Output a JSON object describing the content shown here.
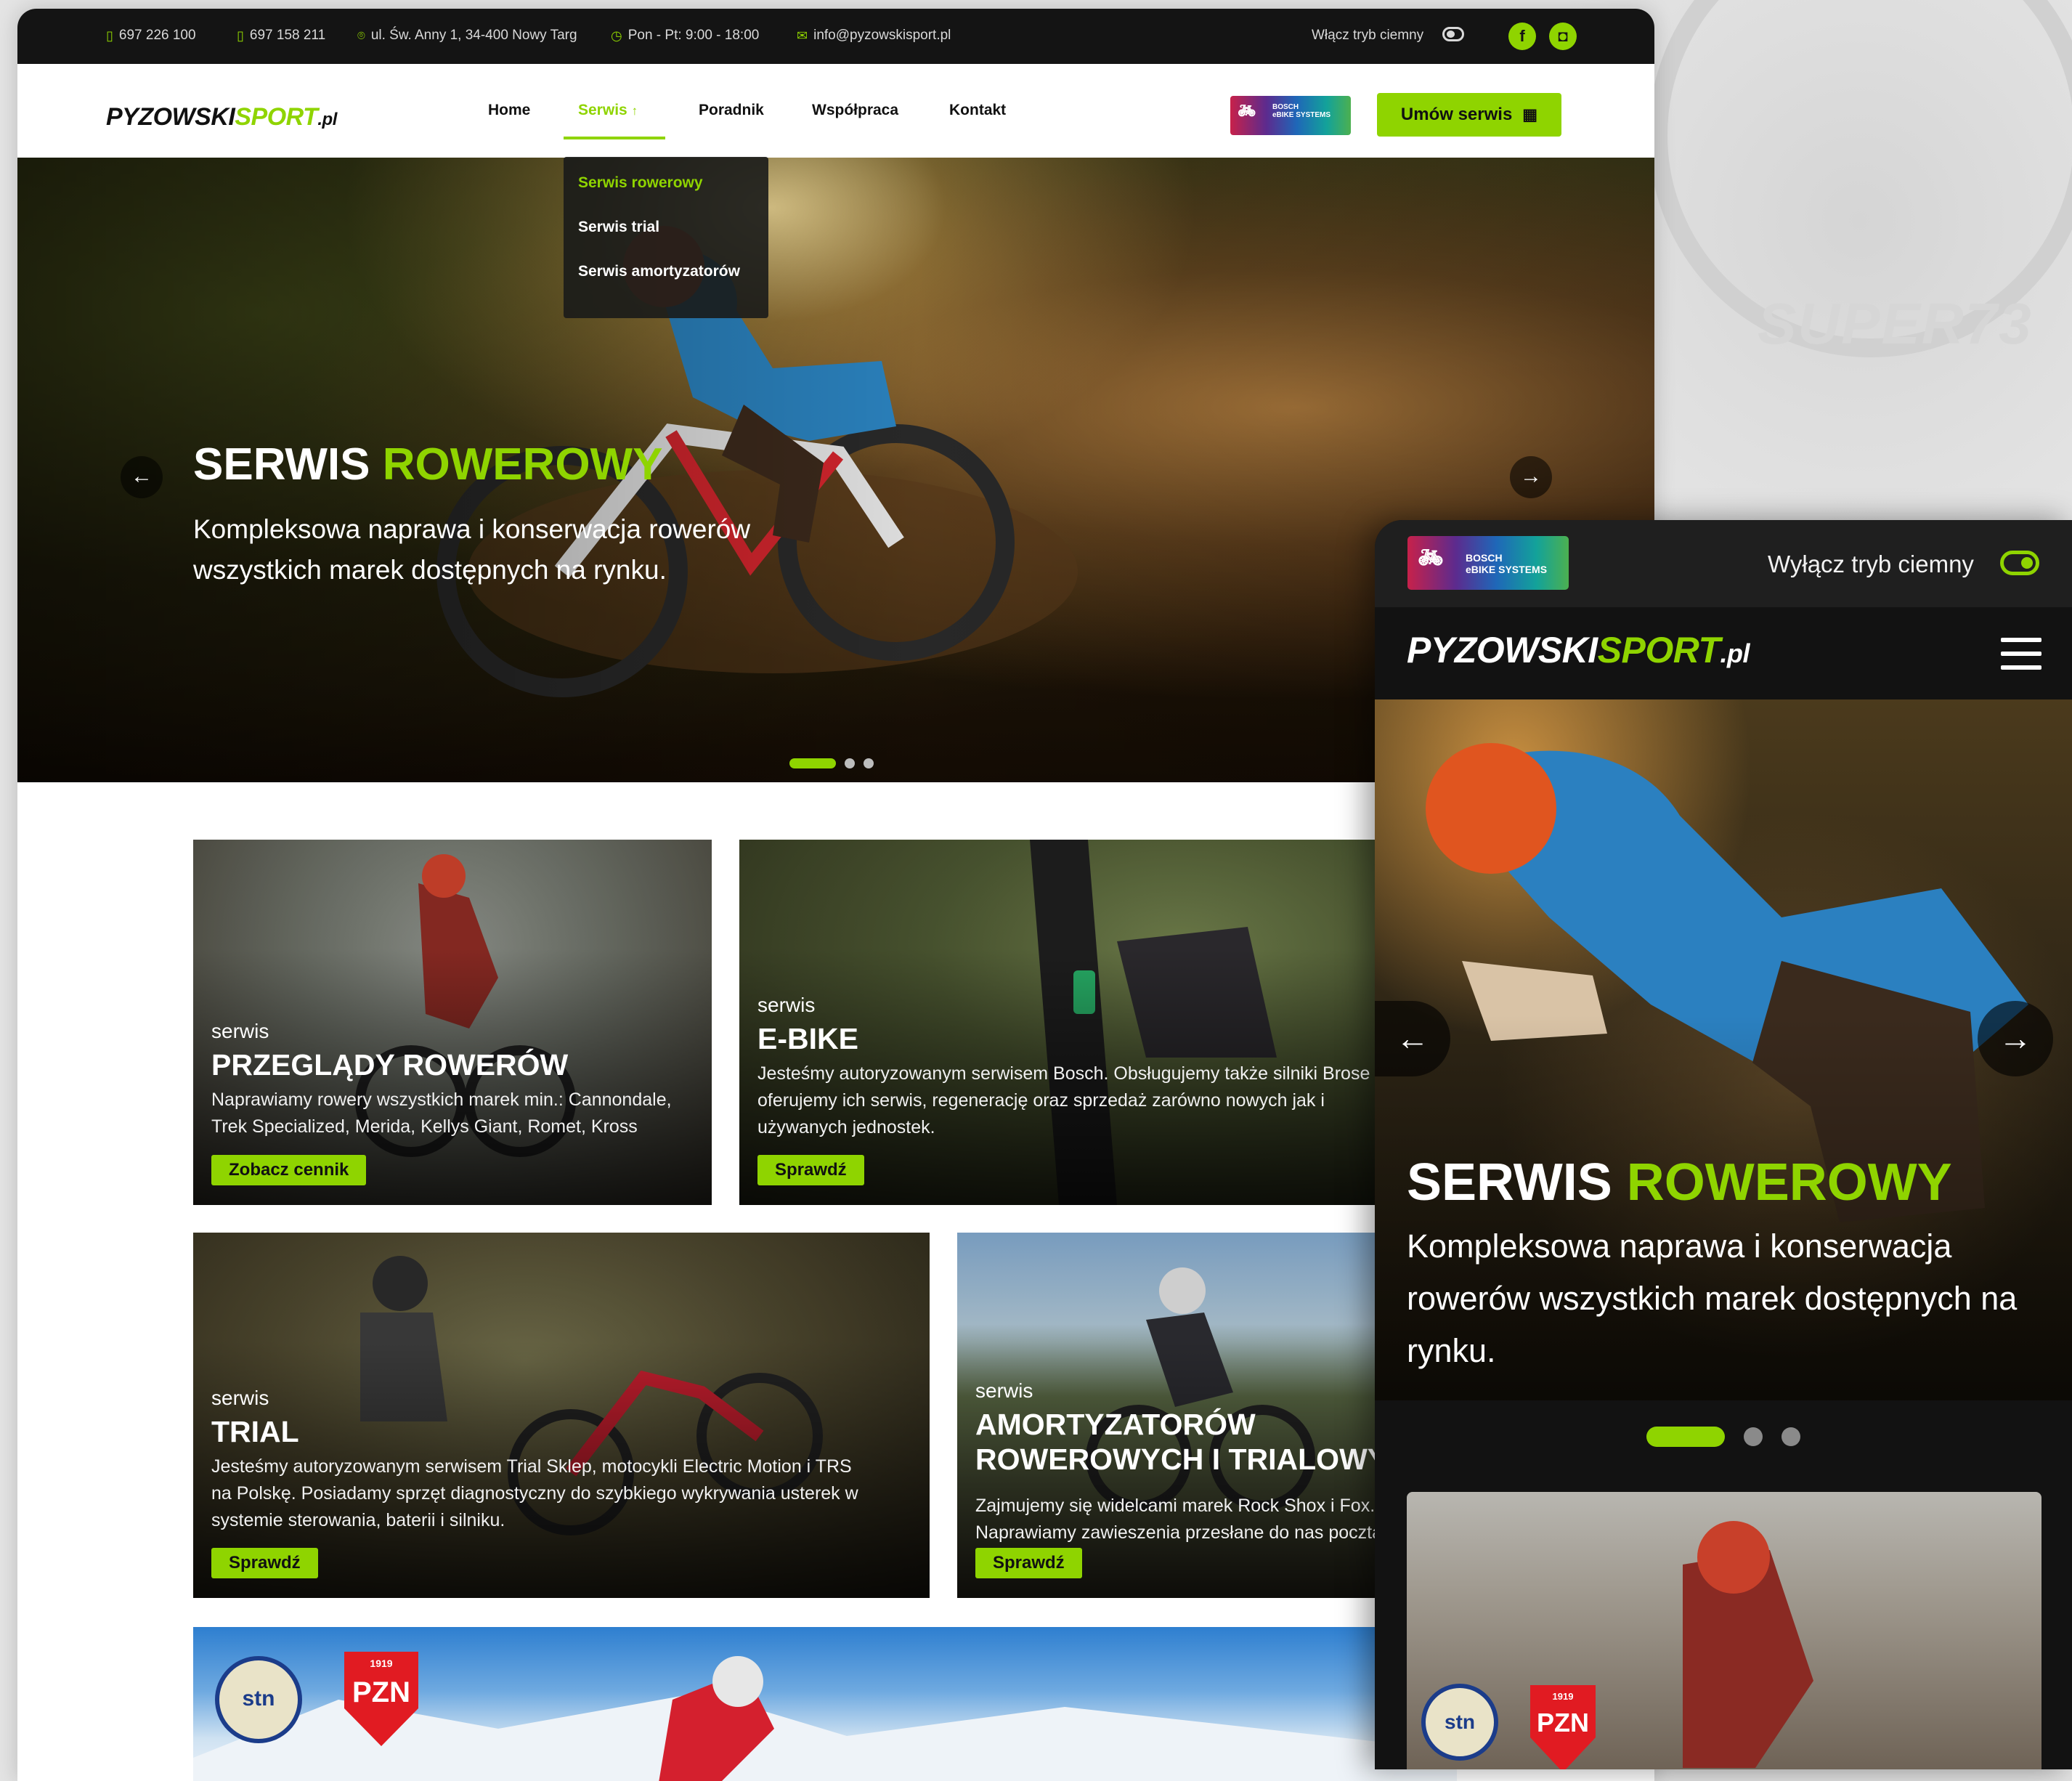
{
  "topbar": {
    "phone1": "697 226 100",
    "phone2": "697 158 211",
    "address": "ul. Św. Anny 1, 34-400 Nowy Targ",
    "hours": "Pon - Pt: 9:00 - 18:00",
    "email": "info@pyzowskisport.pl",
    "dark_mode_label": "Włącz tryb ciemny",
    "social": [
      {
        "icon": "facebook-icon"
      },
      {
        "icon": "instagram-icon"
      }
    ]
  },
  "brand": {
    "name_a": "PYZOWSKI",
    "name_b": "SPORT",
    "tld": ".pl",
    "accent": "#8fd400"
  },
  "nav": {
    "items": [
      "Home",
      "Serwis",
      "Poradnik",
      "Współpraca",
      "Kontakt"
    ],
    "active": "Serwis",
    "dropdown": [
      "Serwis rowerowy",
      "Serwis trial",
      "Serwis amortyzatorów"
    ],
    "bosch_line1": "BOSCH",
    "bosch_line2": "eBIKE SYSTEMS",
    "cta": "Umów serwis"
  },
  "hero": {
    "title_a": "SERWIS ",
    "title_b": "ROWEROWY",
    "subtitle": "Kompleksowa naprawa i konserwacja rowerów wszystkich marek dostępnych na rynku.",
    "slide_count": 3,
    "active_slide": 1
  },
  "cards": [
    {
      "kicker": "serwis",
      "title": "PRZEGLĄDY ROWERÓW",
      "desc": "Naprawiamy rowery wszystkich marek min.: Cannondale, Trek Specialized, Merida, Kellys Giant, Romet, Kross",
      "button": "Zobacz cennik"
    },
    {
      "kicker": "serwis",
      "title": "E-BIKE",
      "desc": "Jesteśmy autoryzowanym serwisem Bosch. Obsługujemy także silniki Brose – oferujemy ich serwis, regenerację oraz sprzedaż zarówno nowych jak i używanych jednostek.",
      "button": "Sprawdź"
    },
    {
      "kicker": "serwis",
      "title": "TRIAL",
      "desc": "Jesteśmy autoryzowanym serwisem Trial Sklep, motocykli Electric Motion i TRS na Polskę. Posiadamy sprzęt diagnostyczny do szybkiego wykrywania usterek w systemie sterowania, baterii i silniku.",
      "button": "Sprawdź"
    },
    {
      "kicker": "serwis",
      "title": "AMORTYZATORÓW ROWEROWYCH I TRIALOWYCH",
      "desc": "Zajmujemy się widelcami marek Rock Shox i Fox. Naprawiamy zawieszenia przesłane do nas pocztą.",
      "button": "Sprawdź"
    }
  ],
  "badges": {
    "pzn_year": "1919",
    "pzn": "PZN",
    "stn": "stn"
  },
  "mobile": {
    "dark_mode_label": "Wyłącz tryb ciemny",
    "hero_title_a": "SERWIS ",
    "hero_title_b": "ROWEROWY",
    "hero_subtitle": "Kompleksowa naprawa i konserwacja rowerów wszystkich marek dostępnych na rynku."
  }
}
